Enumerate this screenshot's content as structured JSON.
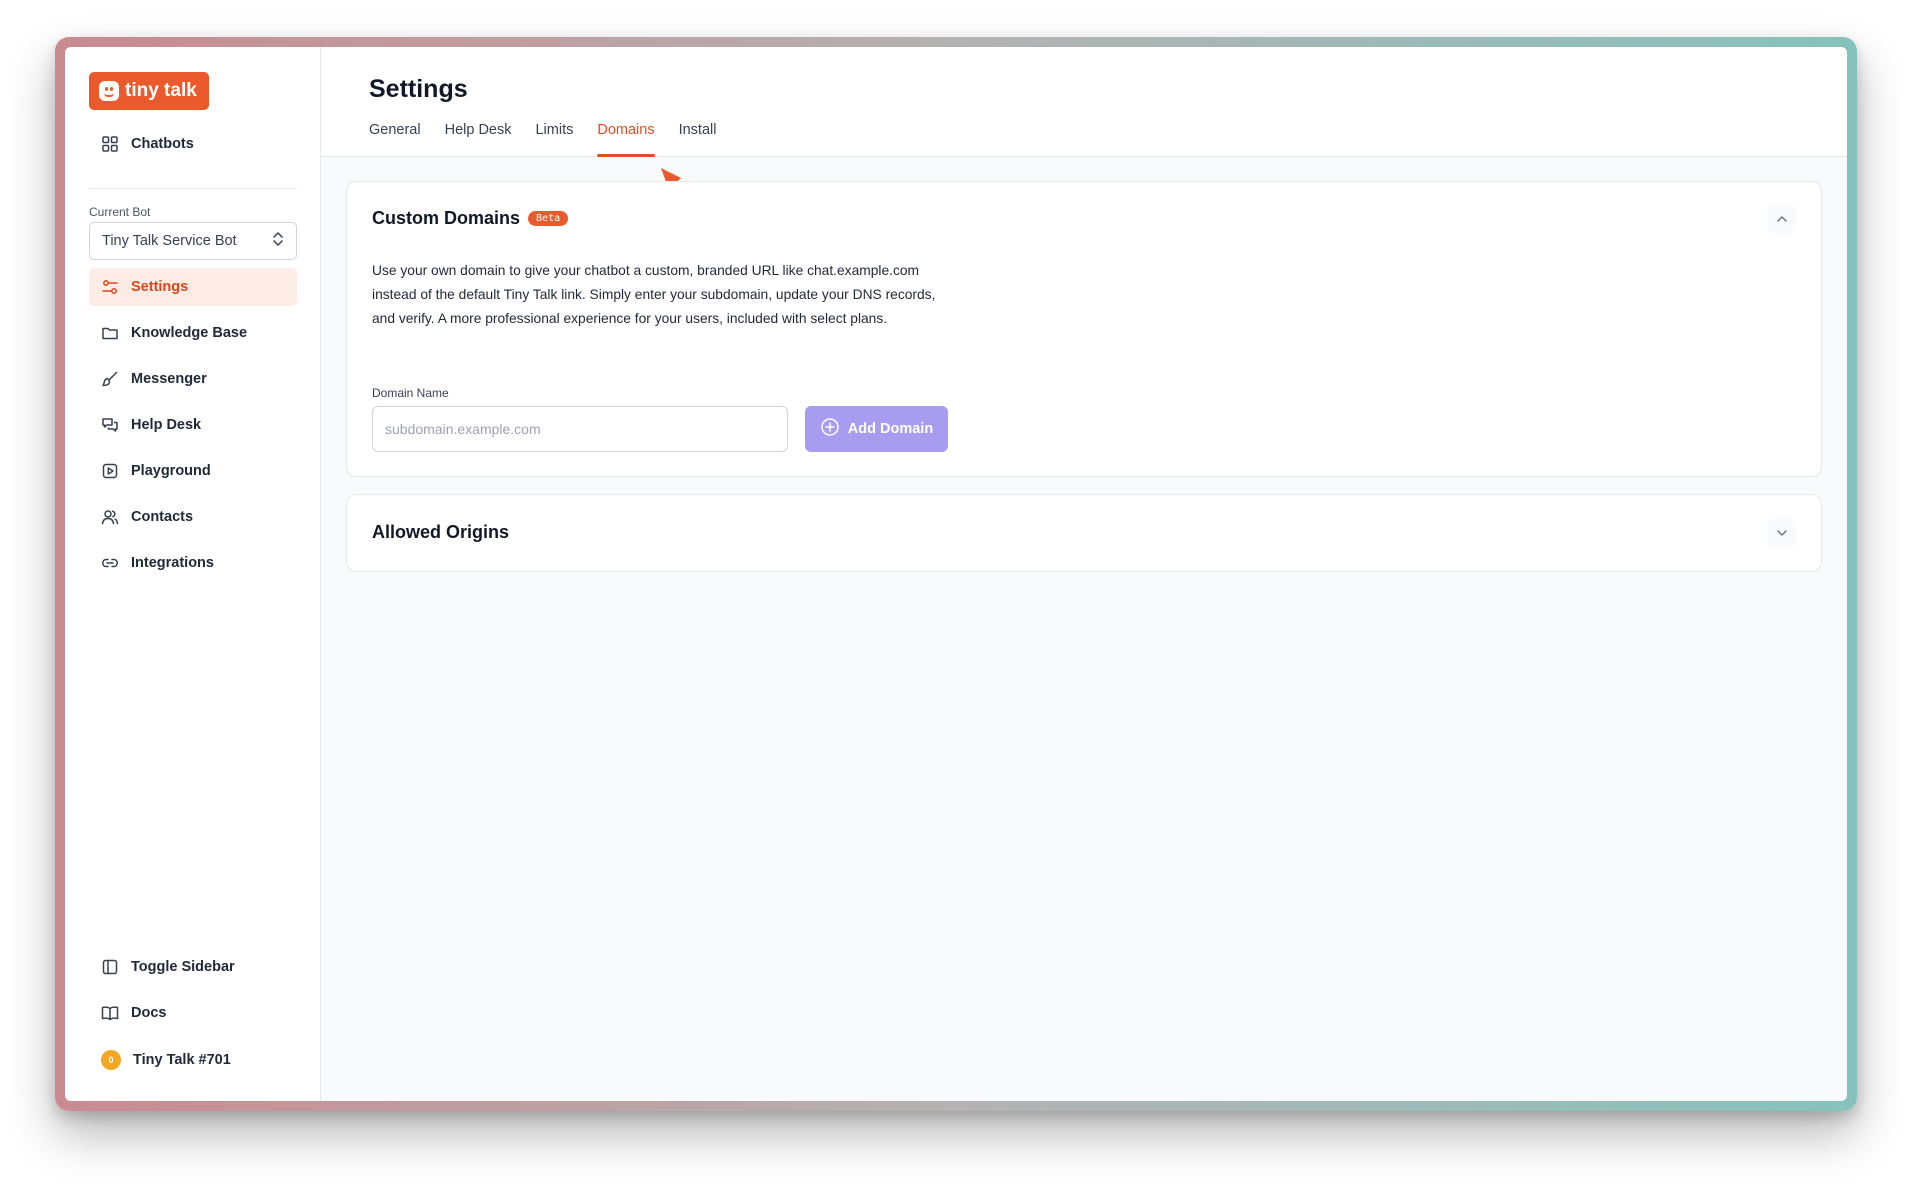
{
  "brand": {
    "name": "tiny talk",
    "color": "#ea5a2c"
  },
  "sidebar": {
    "chatbots_label": "Chatbots",
    "current_bot_label": "Current Bot",
    "current_bot_value": "Tiny Talk Service Bot",
    "items": [
      {
        "label": "Settings",
        "icon": "sliders-icon",
        "active": true
      },
      {
        "label": "Knowledge Base",
        "icon": "folder-icon"
      },
      {
        "label": "Messenger",
        "icon": "brush-icon"
      },
      {
        "label": "Help Desk",
        "icon": "chat-bubbles-icon"
      },
      {
        "label": "Playground",
        "icon": "play-square-icon"
      },
      {
        "label": "Contacts",
        "icon": "users-icon"
      },
      {
        "label": "Integrations",
        "icon": "link-icon"
      }
    ],
    "bottom": {
      "toggle_label": "Toggle Sidebar",
      "docs_label": "Docs",
      "account_label": "Tiny Talk #701",
      "account_badge": "0"
    }
  },
  "header": {
    "title": "Settings",
    "tabs": [
      "General",
      "Help Desk",
      "Limits",
      "Domains",
      "Install"
    ],
    "active_tab": "Domains"
  },
  "custom_domains": {
    "title": "Custom Domains",
    "badge": "Beta",
    "description": "Use your own domain to give your chatbot a custom, branded URL like chat.example.com instead of the default Tiny Talk link. Simply enter your subdomain, update your DNS records, and verify. A more professional experience for your users, included with select plans.",
    "field_label": "Domain Name",
    "input_placeholder": "subdomain.example.com",
    "input_value": "",
    "add_button": "Add Domain"
  },
  "allowed_origins": {
    "title": "Allowed Origins"
  }
}
